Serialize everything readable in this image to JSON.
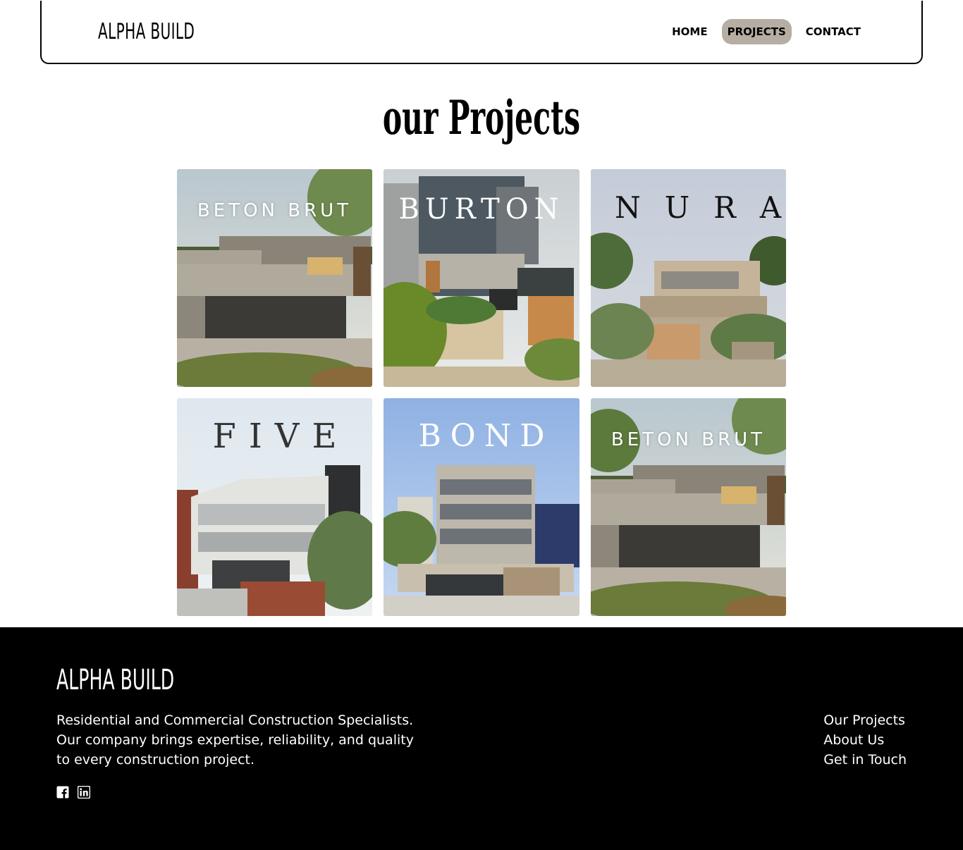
{
  "header": {
    "brand": "ALPHA BUILD",
    "nav": [
      {
        "label": "HOME",
        "active": false
      },
      {
        "label": "PROJECTS",
        "active": true
      },
      {
        "label": "CONTACT",
        "active": false
      }
    ],
    "active_color": "#b6aea3"
  },
  "page": {
    "title": "our Projects"
  },
  "projects": [
    {
      "name": "BETON BRUT"
    },
    {
      "name": "BURTON"
    },
    {
      "name": "NURA"
    },
    {
      "name": "FIVE"
    },
    {
      "name": "BOND"
    },
    {
      "name": "BETON BRUT"
    }
  ],
  "footer": {
    "brand": "ALPHA BUILD",
    "desc_line1": "Residential and Commercial Construction Specialists.",
    "desc_line2": "Our company brings expertise, reliability, and quality to every construction project.",
    "social": [
      {
        "icon": "facebook-icon"
      },
      {
        "icon": "linkedin-icon"
      }
    ],
    "links": [
      "Our Projects",
      "About Us",
      "Get in Touch"
    ]
  }
}
